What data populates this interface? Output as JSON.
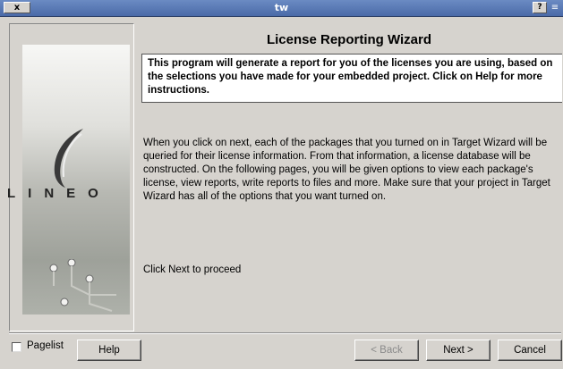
{
  "window": {
    "title": "tw",
    "close_label": "x",
    "help_label": "?",
    "menu_label": "≡"
  },
  "sidebar": {
    "logo_text": "LINEO"
  },
  "wizard": {
    "title": "License Reporting Wizard",
    "intro": "This program will generate a report for you of the licenses you are using, based on the selections you have made for your embedded project. Click on Help for more instructions.",
    "body": "When you click on next, each of the packages that you turned on in Target Wizard will be queried for their license information. From that information, a license database will be constructed. On the following pages, you will be given options to view each package's license, view reports, write reports to files and more. Make sure that your project in Target Wizard has all of the options that you want turned on.",
    "proceed": "Click Next to proceed"
  },
  "footer": {
    "pagelist_label": "Pagelist",
    "pagelist_checked": false,
    "help_button": "Help",
    "back_button": "< Back",
    "next_button": "Next >",
    "cancel_button": "Cancel"
  }
}
